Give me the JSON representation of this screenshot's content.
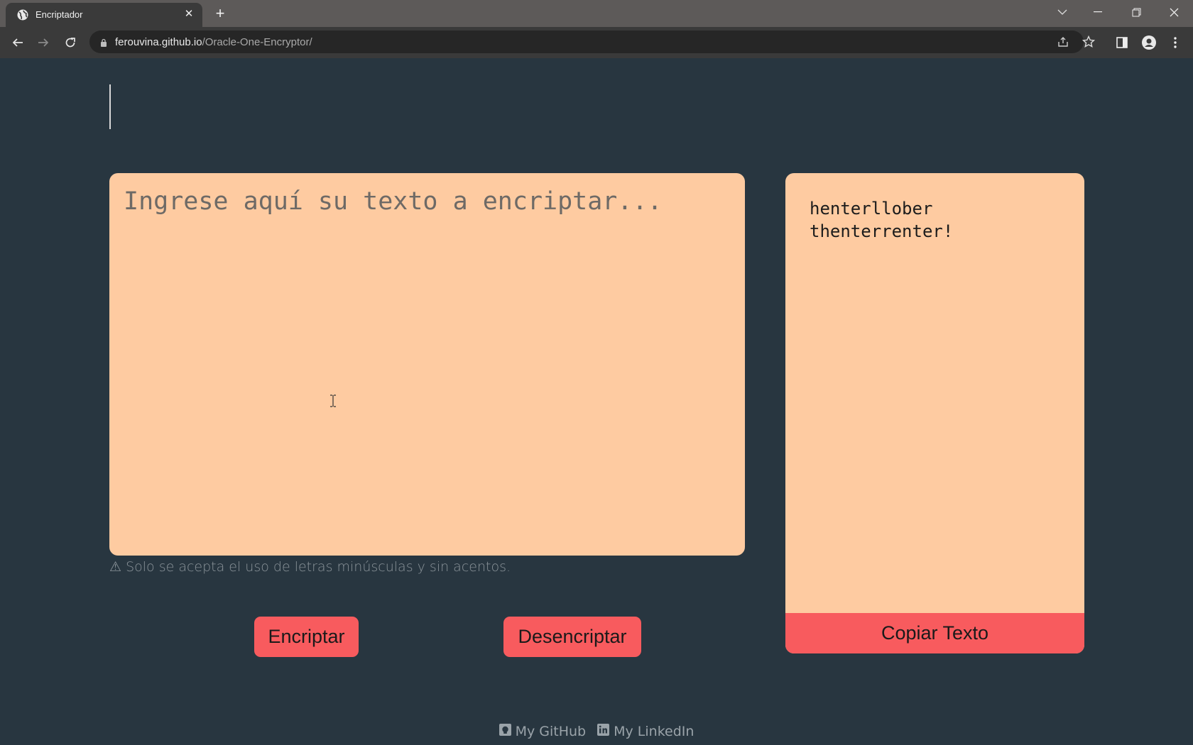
{
  "browser": {
    "tab_title": "Encriptador",
    "url_host": "ferouvina.github.io",
    "url_path": "/Oracle-One-Encryptor/"
  },
  "page": {
    "input_placeholder": "Ingrese aquí su texto a encriptar...",
    "input_value": "",
    "warning": "⚠ Solo se acepta el uso de letras minúsculas y sin acentos.",
    "encrypt_label": "Encriptar",
    "decrypt_label": "Desencriptar",
    "output_text": "henterllober\nthenterrenter!",
    "copy_label": "Copiar Texto"
  },
  "footer": {
    "github_label": "My GitHub",
    "linkedin_label": "My LinkedIn"
  },
  "colors": {
    "background": "#283640",
    "panel": "#fecba1",
    "accent": "#f85b5e"
  },
  "icons": [
    "globe-icon",
    "close-icon",
    "plus-icon",
    "back-icon",
    "forward-icon",
    "reload-icon",
    "lock-icon",
    "share-icon",
    "star-icon",
    "sidebar-icon",
    "profile-icon",
    "menu-icon",
    "github-icon",
    "linkedin-icon"
  ]
}
